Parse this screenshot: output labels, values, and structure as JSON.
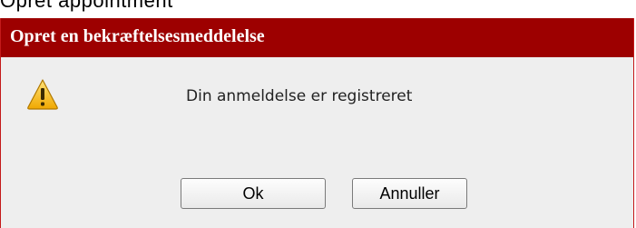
{
  "page": {
    "top_fragment": "Opret appointment"
  },
  "dialog": {
    "title": "Opret en bekræftelsesmeddelelse",
    "icon": "warning-icon",
    "message": "Din anmeldelse er registreret",
    "buttons": {
      "ok_label": "Ok",
      "cancel_label": "Annuller"
    }
  },
  "colors": {
    "titlebar": "#9d0000",
    "dialog_background": "#eeeeee",
    "warning_icon": "#f5b400"
  }
}
